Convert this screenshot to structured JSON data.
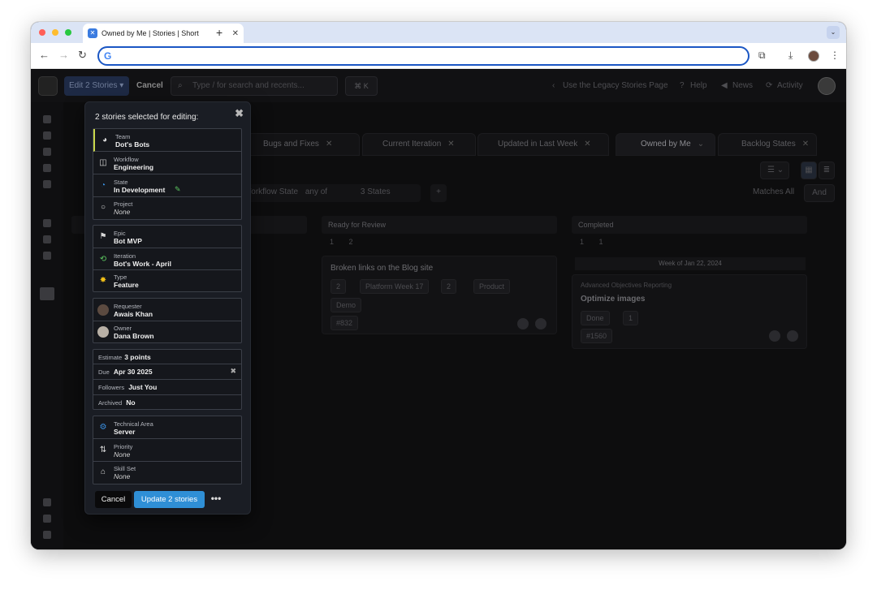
{
  "browser": {
    "tab_title": "Owned by Me | Stories | Short",
    "tab_close": "✕",
    "new_tab": "+",
    "tab_menu": "⌄",
    "omnibox_icon": "G"
  },
  "topbar": {
    "edit_label": "Edit 2 Stories ▾",
    "cancel_label": "Cancel",
    "search_placeholder": "Type / for search and recents...",
    "shortcut": "⌘ K",
    "legacy_link": "Use the Legacy Stories Page",
    "help": "Help",
    "news": "News",
    "activity": "Activity"
  },
  "story_tabs": [
    {
      "label": "Bugs and Fixes"
    },
    {
      "label": "Current Iteration"
    },
    {
      "label": "Updated in Last Week"
    },
    {
      "label": "Owned by Me"
    },
    {
      "label": "Backlog States"
    }
  ],
  "filters": {
    "workflow_state": "Workflow State",
    "any_of": "any of",
    "states": "3 States",
    "matches": "Matches All",
    "and": "And"
  },
  "columns": {
    "ready_for_review": "Ready for Review",
    "completed": "Completed",
    "ready_count_a": "1",
    "ready_count_b": "2",
    "completed_count_a": "1",
    "completed_count_b": "1"
  },
  "cards": {
    "broken_links": {
      "title": "Broken links on the Blog site",
      "estimate": "2",
      "iteration": "Platform Week 17",
      "points": "2",
      "product": "Product",
      "demo": "Demo",
      "id": "#832"
    },
    "week_label": "Week of Jan 22, 2024",
    "optimize": {
      "epic": "Advanced Objectives Reporting",
      "title": "Optimize images",
      "state": "Done",
      "points": "1",
      "id": "#1560"
    }
  },
  "modal": {
    "title": "2 stories selected for editing:",
    "close": "✖",
    "team": {
      "label": "Team",
      "value": "Dot's Bots"
    },
    "workflow": {
      "label": "Workflow",
      "value": "Engineering"
    },
    "state": {
      "label": "State",
      "value": "In Development"
    },
    "project": {
      "label": "Project",
      "value": "None"
    },
    "epic": {
      "label": "Epic",
      "value": "Bot MVP"
    },
    "iteration": {
      "label": "Iteration",
      "value": "Bot's Work - April"
    },
    "type": {
      "label": "Type",
      "value": "Feature"
    },
    "requester": {
      "label": "Requester",
      "value": "Awais Khan"
    },
    "owner": {
      "label": "Owner",
      "value": "Dana Brown"
    },
    "estimate": {
      "label": "Estimate",
      "value": "3 points"
    },
    "due": {
      "label": "Due",
      "value": "Apr 30 2025"
    },
    "followers": {
      "label": "Followers",
      "value": "Just You"
    },
    "archived": {
      "label": "Archived",
      "value": "No"
    },
    "technical_area": {
      "label": "Technical Area",
      "value": "Server"
    },
    "priority": {
      "label": "Priority",
      "value": "None"
    },
    "skill_set": {
      "label": "Skill Set",
      "value": "None"
    },
    "cancel_button": "Cancel",
    "update_button": "Update 2 stories",
    "more_button": "•••"
  },
  "colors": {
    "accent": "#2f8fd6",
    "team_bar": "#c8d64a",
    "state_blue": "#3a8fe0",
    "type_yellow": "#f2c018",
    "iteration_green": "#5cc760"
  }
}
